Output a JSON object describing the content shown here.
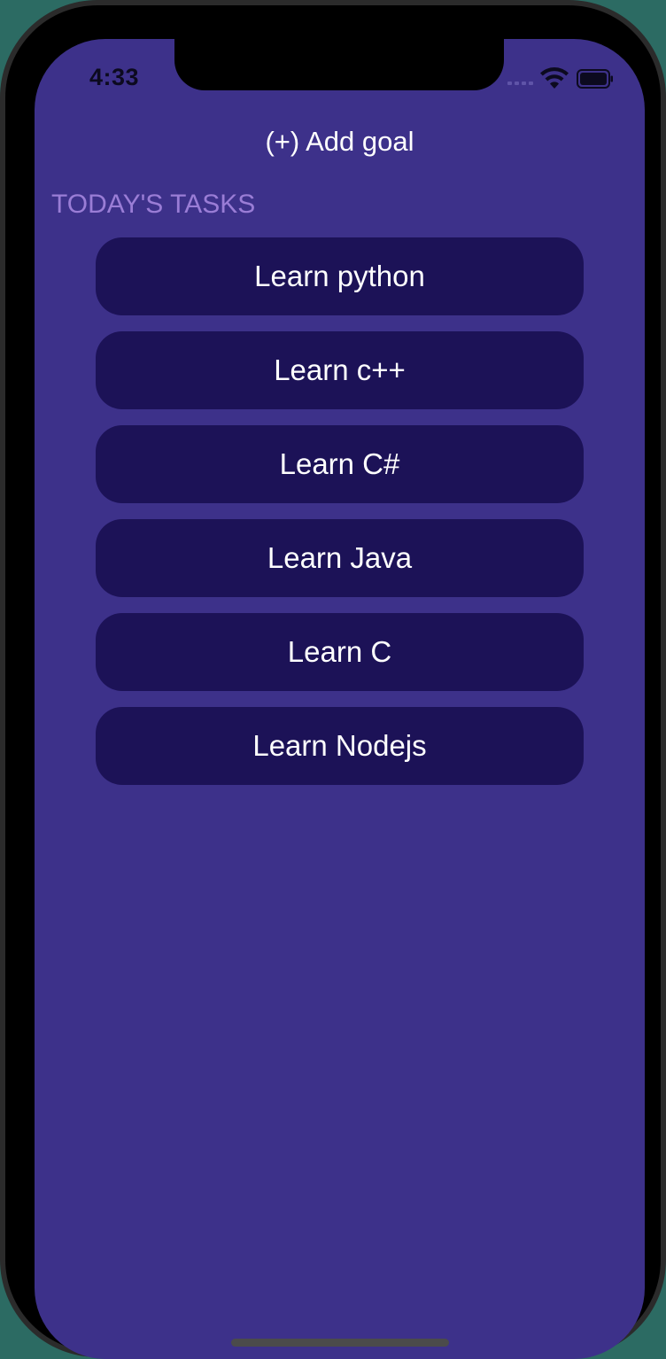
{
  "status_bar": {
    "time": "4:33",
    "icons": [
      "cellular-signal-icon",
      "wifi-icon",
      "battery-icon"
    ]
  },
  "header": {
    "add_goal_label": "(+) Add goal"
  },
  "tasks_section": {
    "title": "TODAY'S TASKS",
    "items": [
      {
        "label": "Learn python"
      },
      {
        "label": "Learn c++"
      },
      {
        "label": "Learn C#"
      },
      {
        "label": "Learn Java"
      },
      {
        "label": "Learn C"
      },
      {
        "label": "Learn Nodejs"
      }
    ]
  },
  "colors": {
    "background": "#3d318a",
    "task_background": "#1c1257",
    "section_title": "#9a7dd6",
    "text": "#ffffff"
  }
}
